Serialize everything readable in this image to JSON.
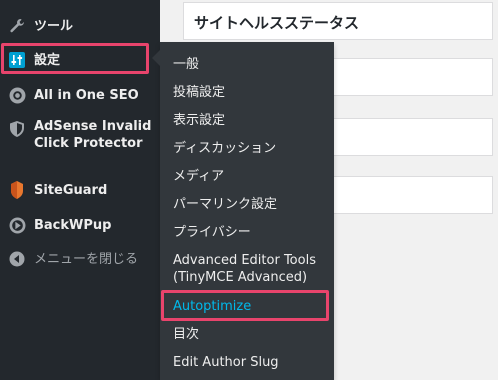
{
  "sidebar": {
    "items": [
      {
        "label": "ツール",
        "icon": "wrench-icon"
      },
      {
        "label": "設定",
        "icon": "settings-sliders-icon"
      },
      {
        "label": "All in One SEO",
        "icon": "gear-icon"
      },
      {
        "label": "AdSense Invalid\nClick Protector",
        "icon": "shield-icon"
      },
      {
        "label": "SiteGuard",
        "icon": "siteguard-logo-icon"
      },
      {
        "label": "BackWPup",
        "icon": "backwpup-logo-icon"
      },
      {
        "label": "メニューを閉じる",
        "icon": "collapse-arrow-icon"
      }
    ]
  },
  "main": {
    "page_title": "サイトヘルスステータス"
  },
  "submenu": {
    "items": [
      {
        "label": "一般"
      },
      {
        "label": "投稿設定"
      },
      {
        "label": "表示設定"
      },
      {
        "label": "ディスカッション"
      },
      {
        "label": "メディア"
      },
      {
        "label": "パーマリンク設定"
      },
      {
        "label": "プライバシー"
      },
      {
        "label": "Advanced Editor Tools\n(TinyMCE Advanced)"
      },
      {
        "label": "Autoptimize"
      },
      {
        "label": "目次"
      },
      {
        "label": "Edit Author Slug"
      }
    ]
  },
  "colors": {
    "sidebar_bg": "#23282d",
    "submenu_bg": "#32373c",
    "highlight": "#e8446c",
    "active_link": "#00b9eb",
    "content_bg": "#f1f1f1"
  }
}
